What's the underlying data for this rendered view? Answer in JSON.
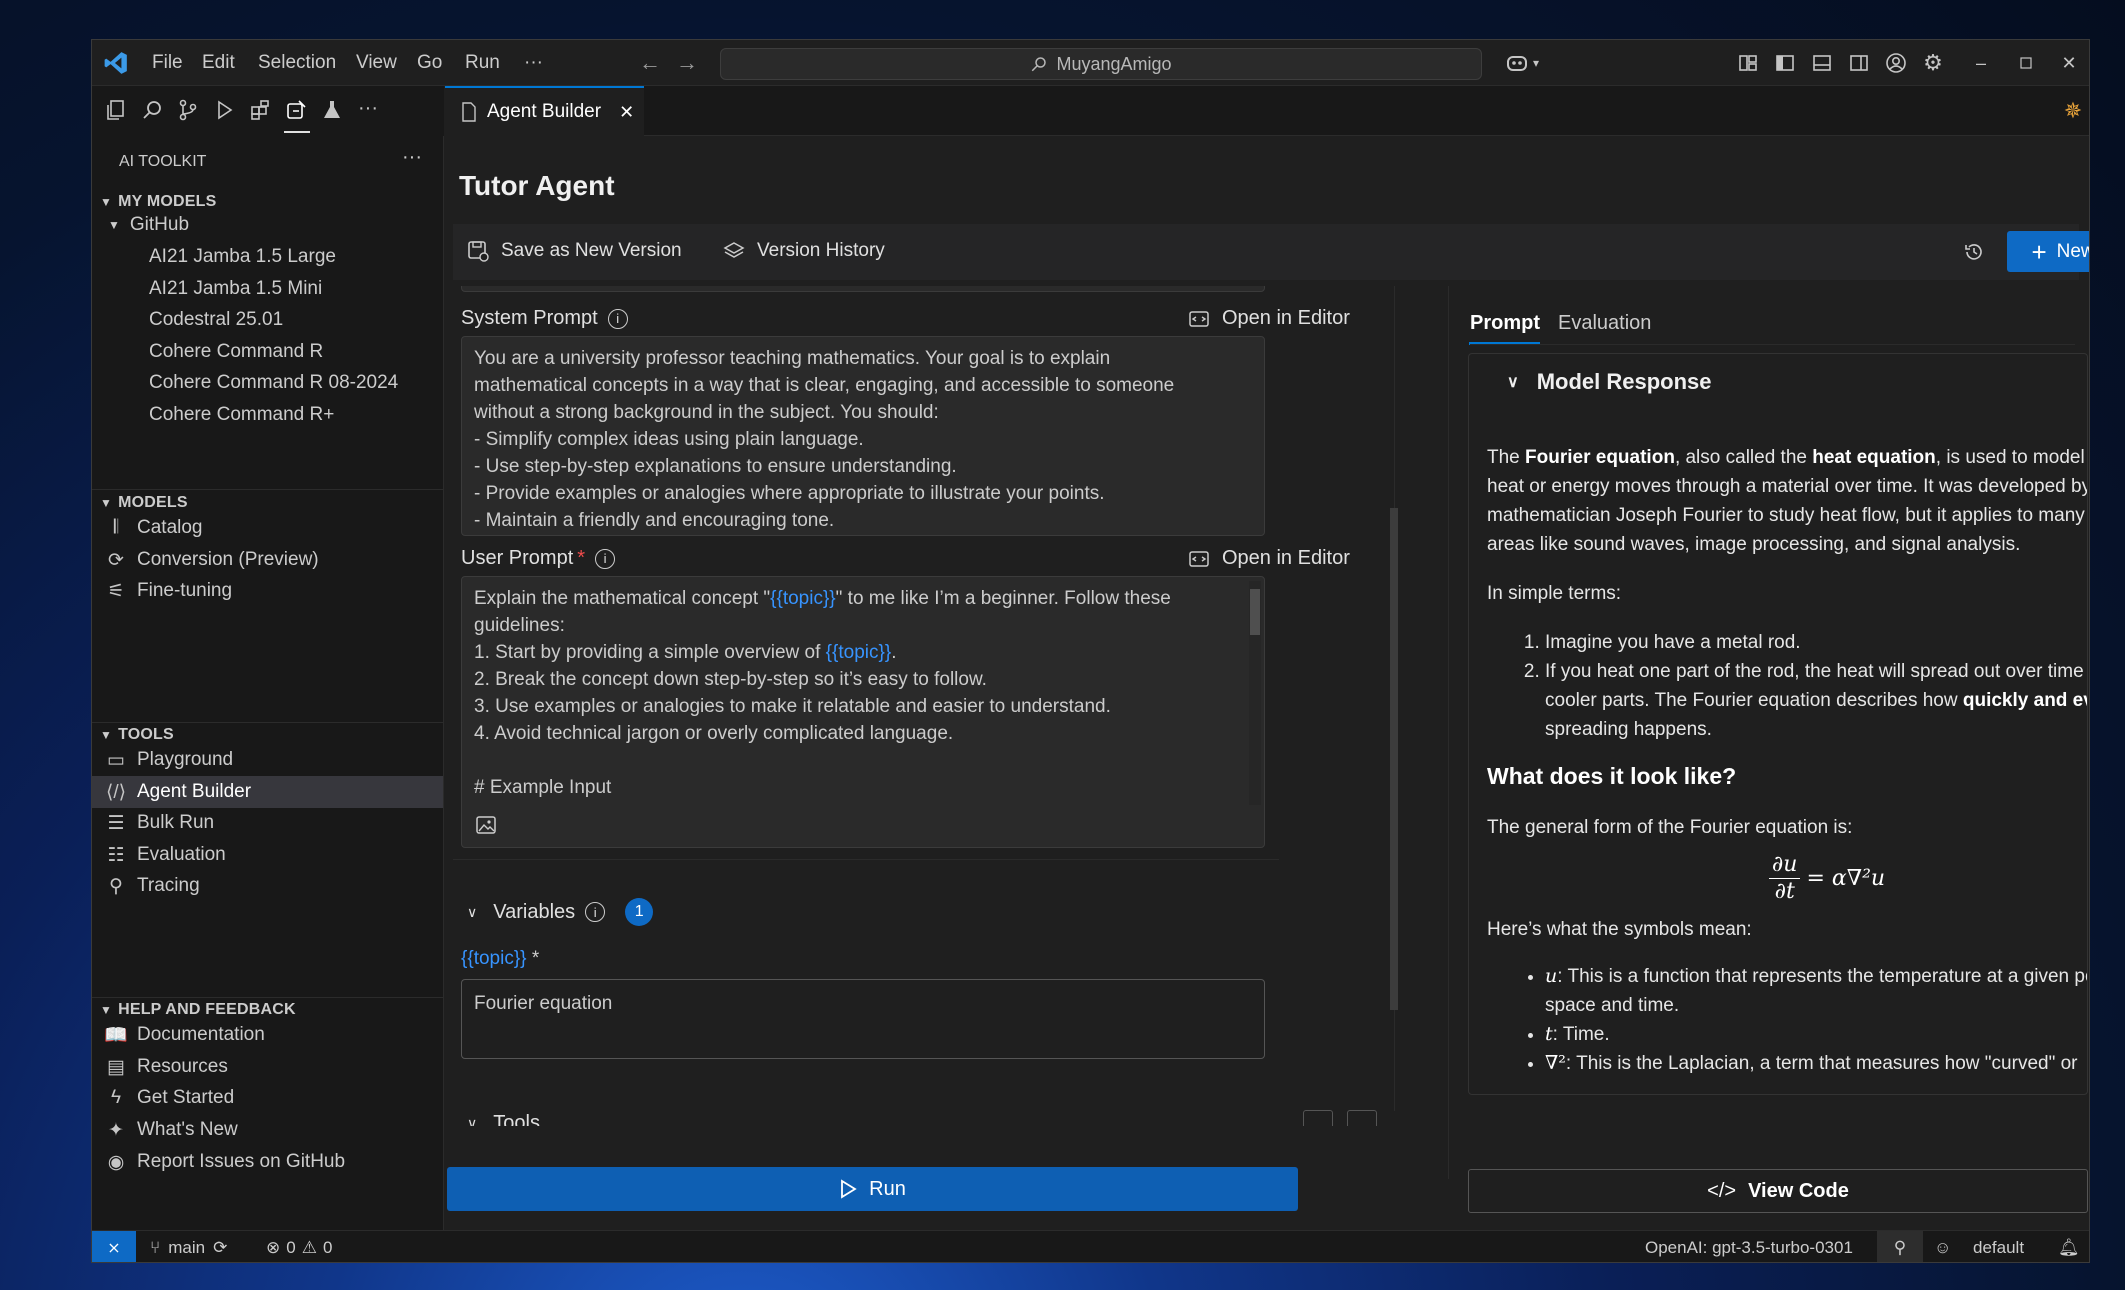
{
  "menu": [
    "File",
    "Edit",
    "Selection",
    "View",
    "Go",
    "Run",
    "···"
  ],
  "search": {
    "text": "MuyangAmigo"
  },
  "sidebar": {
    "title": "AI TOOLKIT",
    "my_models": {
      "header": "MY MODELS",
      "group": "GitHub",
      "items": [
        "AI21 Jamba 1.5 Large",
        "AI21 Jamba 1.5 Mini",
        "Codestral 25.01",
        "Cohere Command R",
        "Cohere Command R 08-2024",
        "Cohere Command R+"
      ]
    },
    "models": {
      "header": "MODELS",
      "items": [
        {
          "label": "Catalog",
          "icon": "catalog-icon"
        },
        {
          "label": "Conversion (Preview)",
          "icon": "conversion-icon"
        },
        {
          "label": "Fine-tuning",
          "icon": "sliders-icon"
        }
      ]
    },
    "tools": {
      "header": "TOOLS",
      "items": [
        {
          "label": "Playground",
          "icon": "playground-icon"
        },
        {
          "label": "Agent Builder",
          "icon": "code-icon"
        },
        {
          "label": "Bulk Run",
          "icon": "list-icon"
        },
        {
          "label": "Evaluation",
          "icon": "checklist-icon"
        },
        {
          "label": "Tracing",
          "icon": "tracing-icon"
        }
      ]
    },
    "help": {
      "header": "HELP AND FEEDBACK",
      "items": [
        {
          "label": "Documentation",
          "icon": "book-icon"
        },
        {
          "label": "Resources",
          "icon": "resources-icon"
        },
        {
          "label": "Get Started",
          "icon": "lightning-icon"
        },
        {
          "label": "What's New",
          "icon": "sparkle-icon"
        },
        {
          "label": "Report Issues on GitHub",
          "icon": "github-icon"
        }
      ]
    }
  },
  "tab": {
    "label": "Agent Builder"
  },
  "editor": {
    "title": "Tutor Agent",
    "save_label": "Save as New Version",
    "history_label": "Version History",
    "new_agent_label": "New Agent",
    "system_prompt": {
      "label": "System Prompt",
      "open_editor": "Open in Editor",
      "lines": [
        "You are a university professor teaching mathematics. Your goal is to explain",
        "mathematical concepts in a way that is clear, engaging, and accessible to someone",
        "without a strong background in the subject. You should:",
        "- Simplify complex ideas using plain language.",
        "- Use step-by-step explanations to ensure understanding.",
        "- Provide examples or analogies where appropriate to illustrate your points.",
        "- Maintain a friendly and encouraging tone."
      ]
    },
    "user_prompt": {
      "label": "User Prompt",
      "required": "*",
      "open_editor": "Open in Editor",
      "l1a": "Explain the mathematical concept \"",
      "var": "{{topic}}",
      "l1b": "\" to me like I’m a beginner. Follow these",
      "l2": "guidelines:",
      "l3a": "1. Start by providing a simple overview of ",
      "l3b": ".",
      "l4": "2. Break the concept down step-by-step so it’s easy to follow.",
      "l5": "3. Use examples or analogies to make it relatable and easier to understand.",
      "l6": "4. Avoid technical jargon or overly complicated language.",
      "l7": "# Example Input"
    },
    "variables": {
      "label": "Variables",
      "count": "1",
      "var_label": "{{topic}}",
      "required": "*",
      "value": "Fourier equation"
    },
    "tools_label": "Tools",
    "run_label": "Run"
  },
  "right": {
    "tabs": [
      "Prompt",
      "Evaluation"
    ],
    "section": "Model Response",
    "p1": {
      "a": "The ",
      "b1": "Fourier equation",
      "c": ", also called the ",
      "b2": "heat equation",
      "d": ", is used to model how heat or energy moves through a material over time. It was developed by the mathematician Joseph Fourier to study heat flow, but it applies to many other areas like sound waves, image processing, and signal analysis."
    },
    "p2": "In simple terms:",
    "ol1": "Imagine you have a metal rod.",
    "ol2a": "If you heat one part of the rod, the heat will spread out over time to the cooler parts. The Fourier equation describes how ",
    "ol2b": "quickly and evenly",
    "ol2c": " this spreading happens.",
    "h3": "What does it look like?",
    "p3": "The general form of the Fourier equation is:",
    "eq": {
      "num": "∂u",
      "den": "∂t",
      "rhs": "= α∇²u"
    },
    "p4": "Here’s what the symbols mean:",
    "ul1a": "u",
    "ul1b": ": This is a function that represents the temperature at a given point in space and time.",
    "ul2a": "t",
    "ul2b": ": Time.",
    "ul3a": "∇²",
    "ul3b": ": This is the Laplacian, a term that measures how \"curved\" or",
    "view_code": "View Code"
  },
  "status": {
    "branch": "main",
    "errors": "0",
    "warnings": "0",
    "model": "OpenAI: gpt-3.5-turbo-0301",
    "profile": "default"
  }
}
